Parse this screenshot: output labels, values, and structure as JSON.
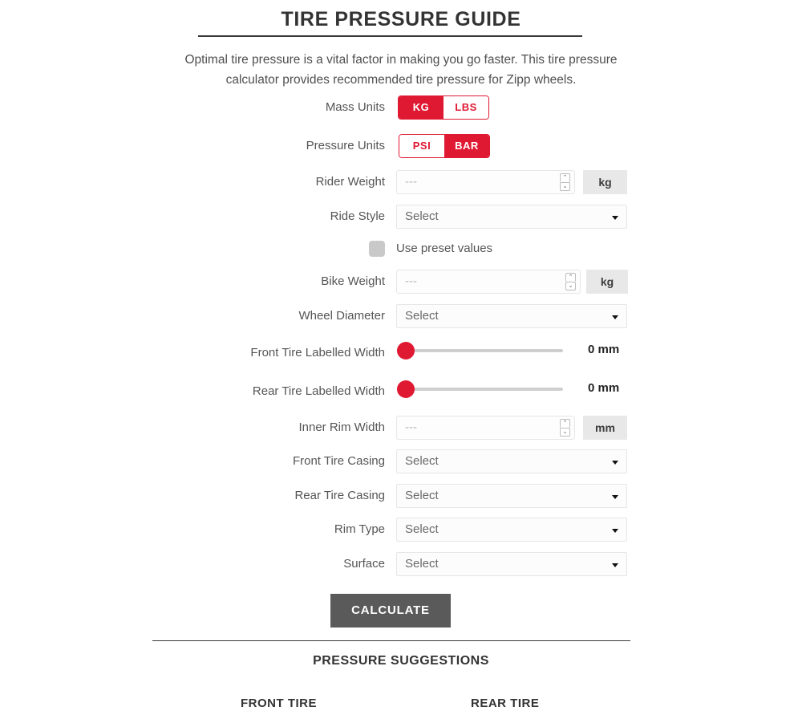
{
  "header": {
    "title": "TIRE PRESSURE GUIDE",
    "intro_line1": "Optimal tire pressure is a vital factor in making you go faster. This tire pressure",
    "intro_line2": "calculator provides recommended tire pressure for Zipp wheels."
  },
  "colors": {
    "accent_red": "#E01933",
    "button_gray": "#5a5a5a",
    "label_gray": "#555555",
    "track_gray": "#cfcfcf"
  },
  "form": {
    "mass_units": {
      "label": "Mass Units",
      "options": [
        "KG",
        "LBS"
      ],
      "selected": "KG"
    },
    "pressure_units": {
      "label": "Pressure Units",
      "options": [
        "PSI",
        "BAR"
      ],
      "selected": "BAR"
    },
    "rider_weight": {
      "label": "Rider Weight",
      "placeholder": "---",
      "value": "---",
      "unit": "kg"
    },
    "ride_style": {
      "label": "Ride Style",
      "value": "Select"
    },
    "preset": {
      "label": "Use preset values",
      "checked": false
    },
    "bike_weight": {
      "label": "Bike Weight",
      "placeholder": "---",
      "value": "---",
      "unit": "kg"
    },
    "wheel_diameter": {
      "label": "Wheel Diameter",
      "value": "Select"
    },
    "front_tire_width": {
      "label": "Front Tire Labelled Width",
      "value": "0 mm",
      "slider_position": 0
    },
    "rear_tire_width": {
      "label": "Rear Tire Labelled Width",
      "value": "0 mm",
      "slider_position": 0
    },
    "inner_rim_width": {
      "label": "Inner Rim Width",
      "placeholder": "---",
      "value": "---",
      "unit": "mm"
    },
    "front_tire_casing": {
      "label": "Front Tire Casing",
      "value": "Select"
    },
    "rear_tire_casing": {
      "label": "Rear Tire Casing",
      "value": "Select"
    },
    "rim_type": {
      "label": "Rim Type",
      "value": "Select"
    },
    "surface": {
      "label": "Surface",
      "value": "Select"
    },
    "calculate_label": "CALCULATE"
  },
  "results": {
    "heading": "PRESSURE SUGGESTIONS",
    "front_tire": "FRONT TIRE",
    "rear_tire": "REAR TIRE"
  },
  "icons": {
    "spinner_up": "⌃",
    "spinner_down": "⌄"
  }
}
